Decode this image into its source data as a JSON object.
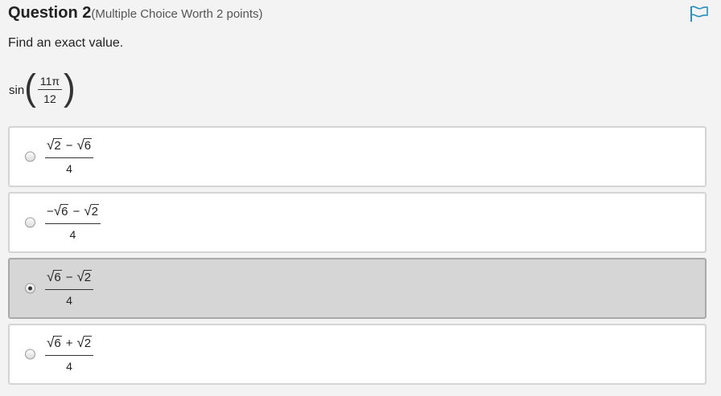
{
  "question": {
    "title": "Question 2",
    "subtitle": "(Multiple Choice Worth 2 points)",
    "prompt": "Find an exact value.",
    "expression": {
      "func": "sin",
      "numerator": "11π",
      "denominator": "12"
    }
  },
  "options": [
    {
      "lead": "",
      "rad1": "2",
      "op": "−",
      "rad2": "6",
      "denominator": "4",
      "selected": false
    },
    {
      "lead": "−",
      "rad1": "6",
      "op": "−",
      "rad2": "2",
      "denominator": "4",
      "selected": false
    },
    {
      "lead": "",
      "rad1": "6",
      "op": "−",
      "rad2": "2",
      "denominator": "4",
      "selected": true
    },
    {
      "lead": "",
      "rad1": "6",
      "op": "+",
      "rad2": "2",
      "denominator": "4",
      "selected": false
    }
  ],
  "colors": {
    "flag": "#2a8fbd",
    "selected_bg": "#d6d6d6",
    "page_bg": "#f3f3f3"
  },
  "icons": {
    "flag": "flag-icon",
    "radical": "√"
  }
}
